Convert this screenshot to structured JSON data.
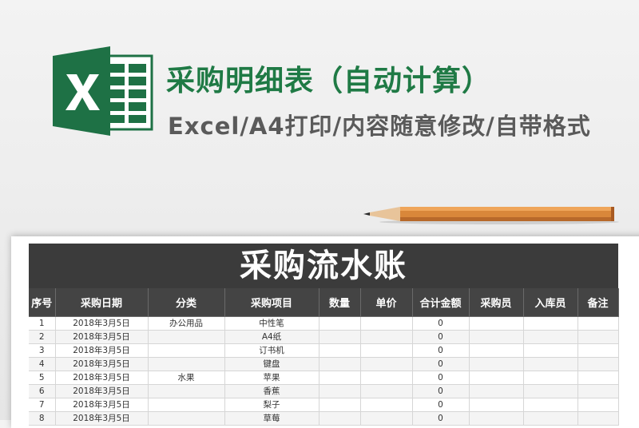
{
  "header": {
    "title": "采购明细表（自动计算）",
    "subtitle": "Excel/A4打印/内容随意修改/自带格式",
    "logo_icon": "excel-logo-icon",
    "accent_color": "#1f7a45"
  },
  "sheet": {
    "banner_title": "采购流水账",
    "columns": [
      "序号",
      "采购日期",
      "分类",
      "采购项目",
      "数量",
      "单价",
      "合计金额",
      "采购员",
      "入库员",
      "备注"
    ],
    "rows": [
      [
        "1",
        "2018年3月5日",
        "办公用品",
        "中性笔",
        "",
        "",
        "0",
        "",
        "",
        ""
      ],
      [
        "2",
        "2018年3月5日",
        "",
        "A4纸",
        "",
        "",
        "0",
        "",
        "",
        ""
      ],
      [
        "3",
        "2018年3月5日",
        "",
        "订书机",
        "",
        "",
        "0",
        "",
        "",
        ""
      ],
      [
        "4",
        "2018年3月5日",
        "",
        "键盘",
        "",
        "",
        "0",
        "",
        "",
        ""
      ],
      [
        "5",
        "2018年3月5日",
        "水果",
        "苹果",
        "",
        "",
        "0",
        "",
        "",
        ""
      ],
      [
        "6",
        "2018年3月5日",
        "",
        "香蕉",
        "",
        "",
        "0",
        "",
        "",
        ""
      ],
      [
        "7",
        "2018年3月5日",
        "",
        "梨子",
        "",
        "",
        "0",
        "",
        "",
        ""
      ],
      [
        "8",
        "2018年3月5日",
        "",
        "草莓",
        "",
        "",
        "0",
        "",
        "",
        ""
      ]
    ]
  }
}
